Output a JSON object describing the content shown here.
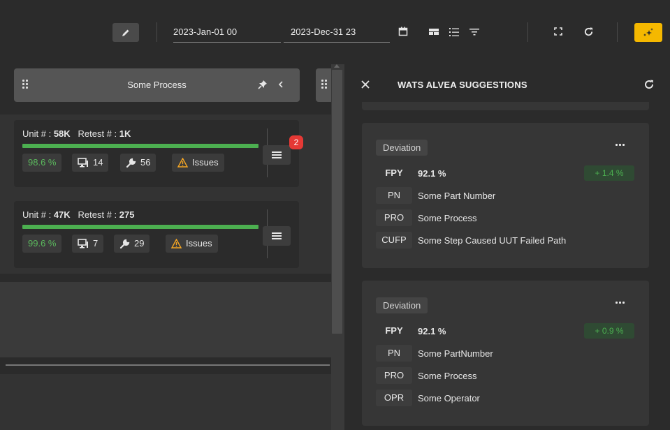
{
  "toolbar": {
    "date_start": "2023-Jan-01 00",
    "date_separator": "-",
    "date_end": "2023-Dec-31 23"
  },
  "left_panel": {
    "title": "Some Process",
    "cards": [
      {
        "units_label": "Unit # :",
        "units_value": "58K",
        "retest_label": "Retest # :",
        "retest_value": "1K",
        "yield": "98.6 %",
        "stations": "14",
        "repairs": "56",
        "issues_label": "Issues",
        "badge": "2",
        "progress": 1.0
      },
      {
        "units_label": "Unit # :",
        "units_value": "47K",
        "retest_label": "Retest # :",
        "retest_value": "275",
        "yield": "99.6 %",
        "stations": "7",
        "repairs": "29",
        "issues_label": "Issues",
        "progress": 1.0
      }
    ]
  },
  "right_panel": {
    "title": "WATS ALVEA SUGGESTIONS",
    "suggestions": [
      {
        "tag": "Deviation",
        "fpy_label": "FPY",
        "fpy_value": "92.1 %",
        "delta": "+ 1.4 %",
        "rows": [
          {
            "key": "PN",
            "value": "Some Part Number"
          },
          {
            "key": "PRO",
            "value": "Some Process"
          },
          {
            "key": "CUFP",
            "value": "Some Step Caused UUT Failed Path"
          }
        ]
      },
      {
        "tag": "Deviation",
        "fpy_label": "FPY",
        "fpy_value": "92.1 %",
        "delta": "+ 0.9 %",
        "rows": [
          {
            "key": "PN",
            "value": "Some PartNumber"
          },
          {
            "key": "PRO",
            "value": "Some Process"
          },
          {
            "key": "OPR",
            "value": "Some Operator"
          }
        ]
      }
    ]
  },
  "colors": {
    "accent": "#f5b800",
    "progress": "#4caf50",
    "badge": "#e53935",
    "positive": "#4caf50"
  },
  "icons": [
    "pencil-icon",
    "calendar-icon",
    "table-view-icon",
    "list-view-icon",
    "filter-icon",
    "fullscreen-icon",
    "refresh-icon",
    "ai-sparkle-icon",
    "drag-handle-icon",
    "pin-icon",
    "chevron-left-icon",
    "monitor-icon",
    "wrench-icon",
    "warning-icon",
    "menu-icon",
    "close-icon",
    "more-icon"
  ]
}
